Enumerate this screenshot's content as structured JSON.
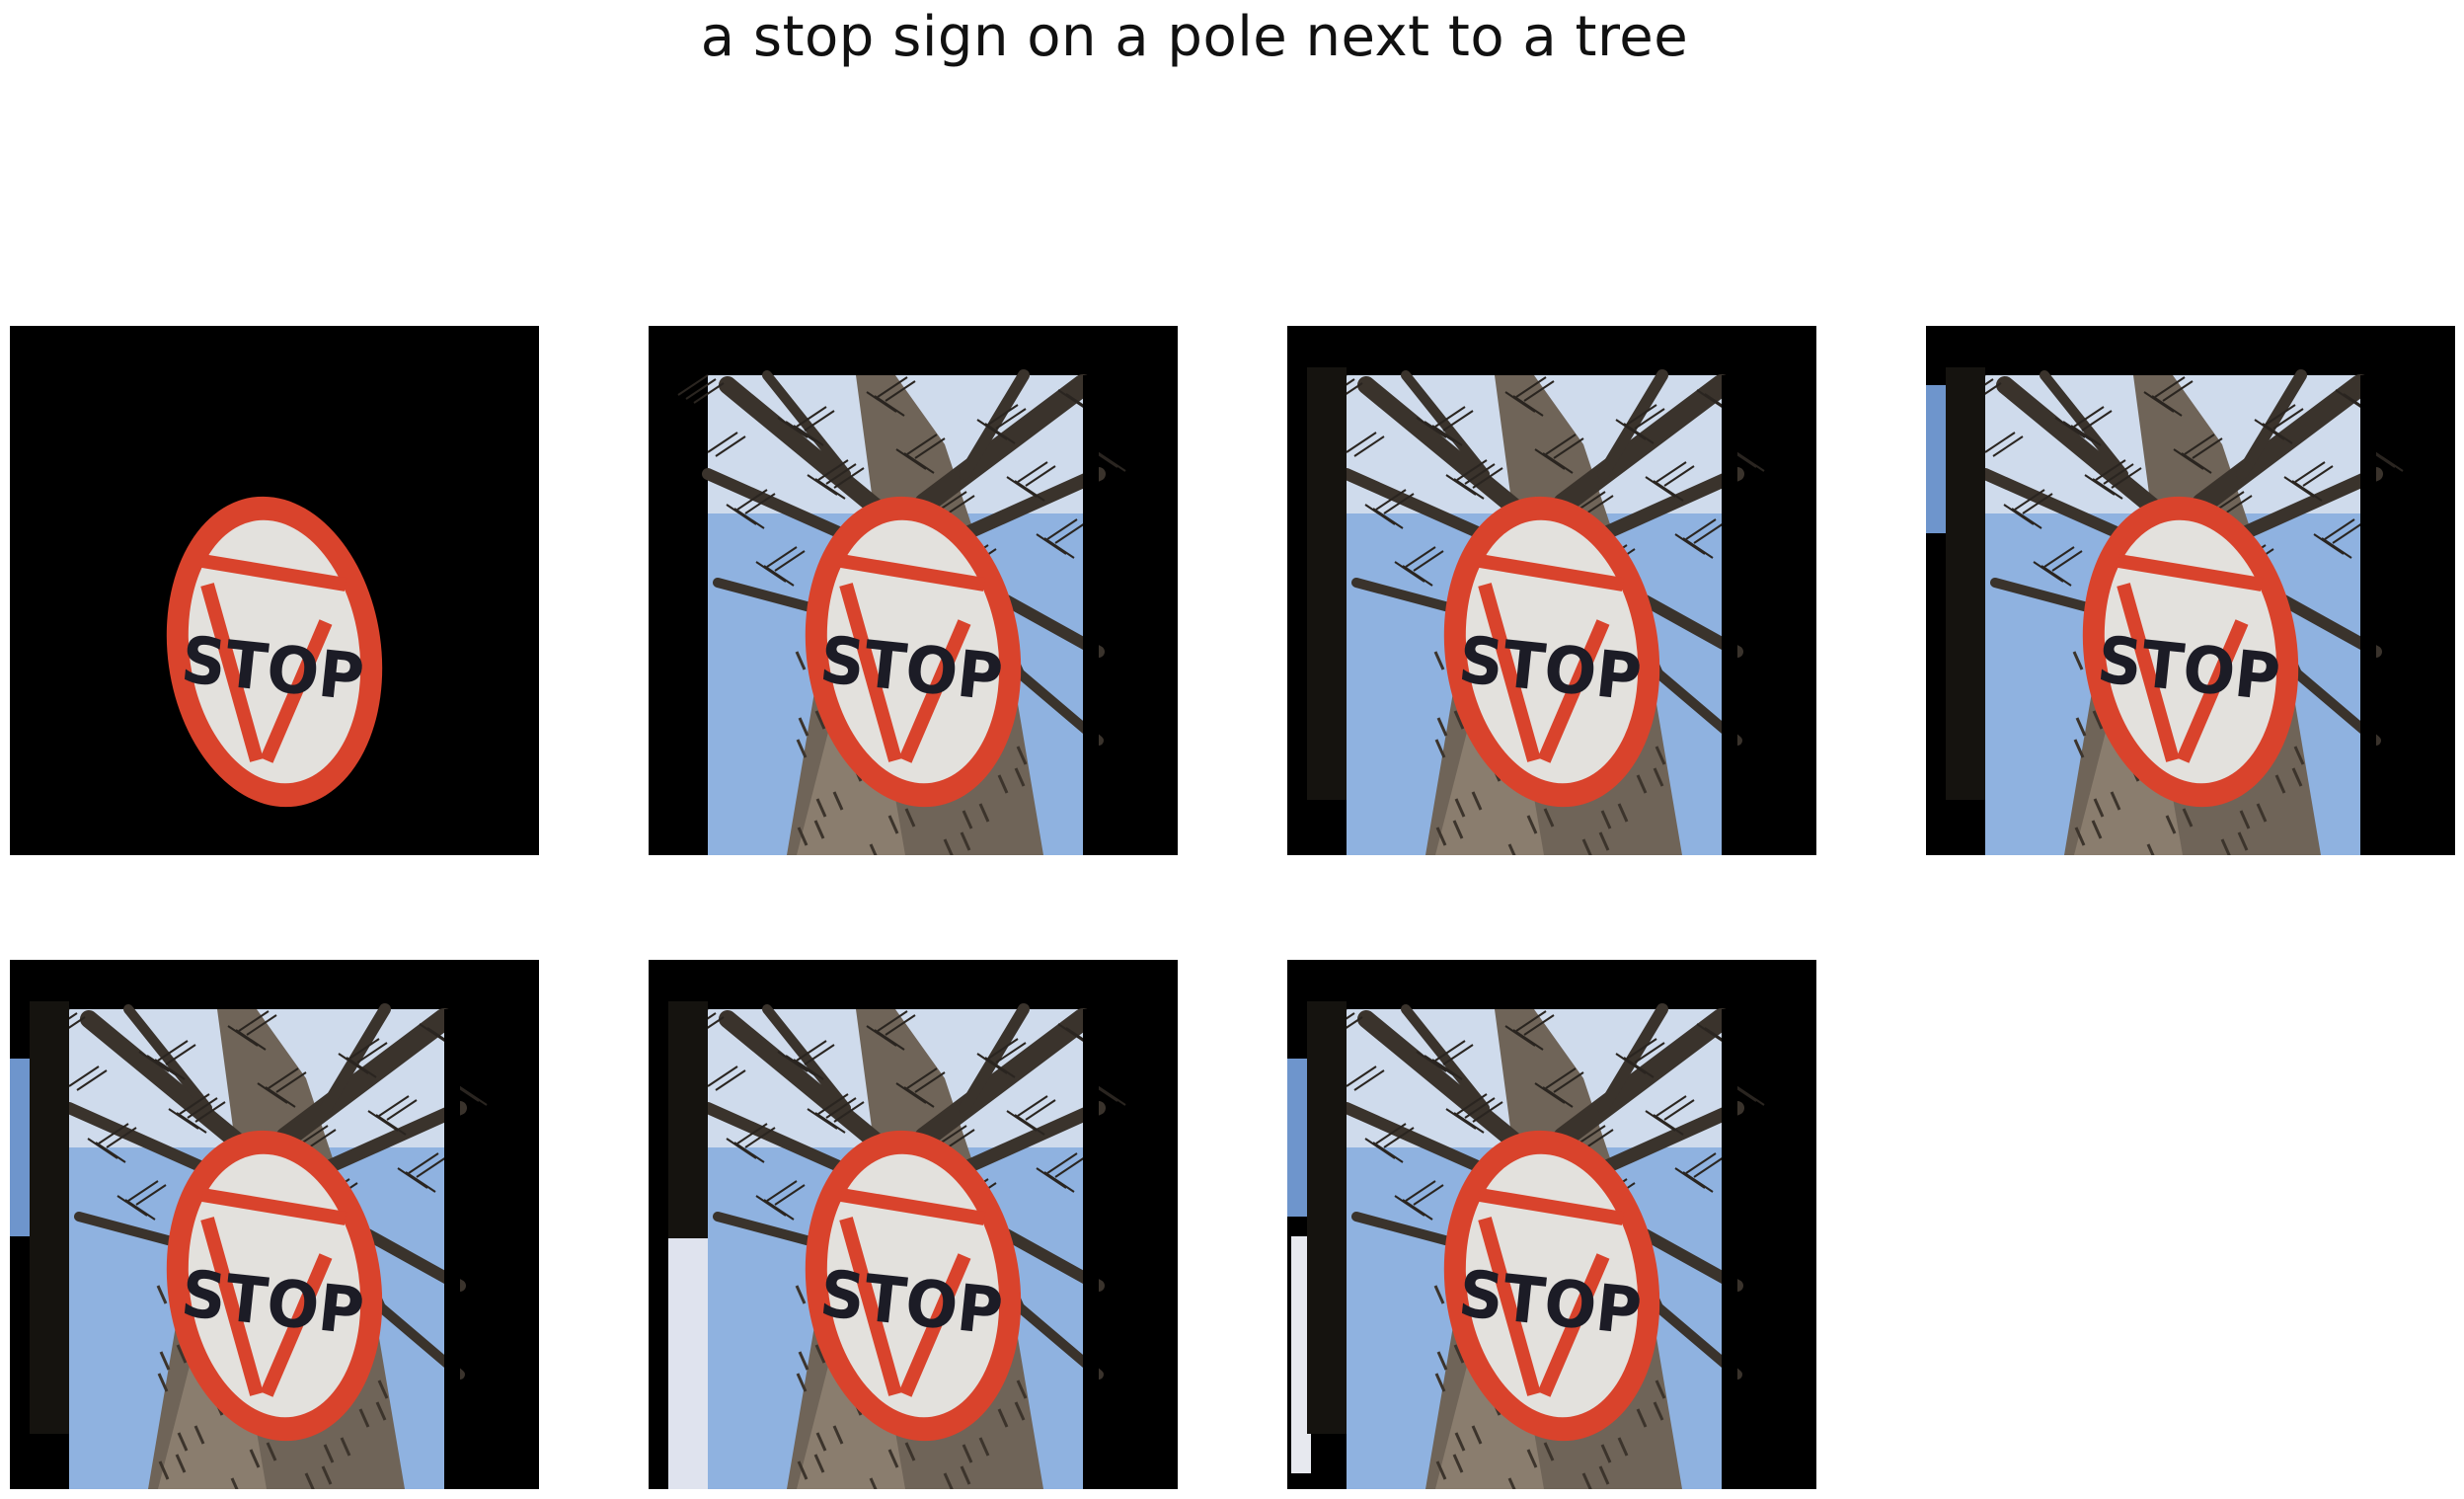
{
  "figure": {
    "title": "a stop sign on a pole next to a tree"
  },
  "sign": {
    "text": "STOP",
    "colors": {
      "ring": "#d9432c",
      "face": "#e3e1dd",
      "text": "#1c1c26"
    }
  },
  "panels": [
    {
      "index": 1,
      "mask": "sign-only",
      "background_visible": false
    },
    {
      "index": 2,
      "mask": "full-scene",
      "background_visible": true
    },
    {
      "index": 3,
      "mask": "scene-with-dark-strip",
      "background_visible": true
    },
    {
      "index": 4,
      "mask": "scene-with-dark-strip",
      "background_visible": true
    },
    {
      "index": 5,
      "mask": "scene-with-dark-strip",
      "background_visible": true
    },
    {
      "index": 6,
      "mask": "scene-with-dark-strip",
      "background_visible": true
    },
    {
      "index": 7,
      "mask": "scene-with-dark-strip",
      "background_visible": true
    }
  ]
}
